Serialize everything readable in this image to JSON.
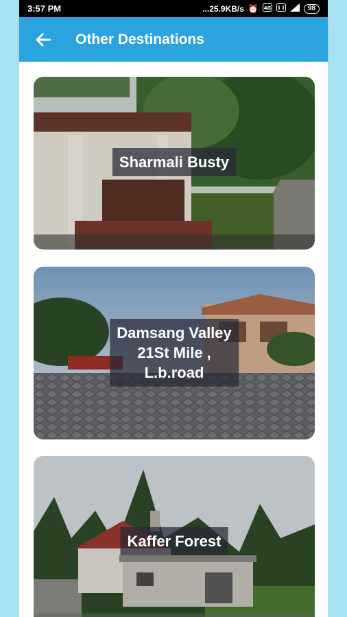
{
  "status_bar": {
    "time": "3:57 PM",
    "network_speed": "...25.9KB/s",
    "battery": "98",
    "icons": [
      "alarm-icon",
      "volte-icon",
      "data-icon",
      "signal-icon",
      "battery-icon"
    ]
  },
  "app_bar": {
    "back_icon": "arrow-left-icon",
    "title": "Other Destinations",
    "color": "#2aa3df"
  },
  "destinations": [
    {
      "name": "Sharmali Busty"
    },
    {
      "name": "Damsang Valley\n21St Mile ,\nL.b.road"
    },
    {
      "name": "Kaffer Forest"
    }
  ]
}
